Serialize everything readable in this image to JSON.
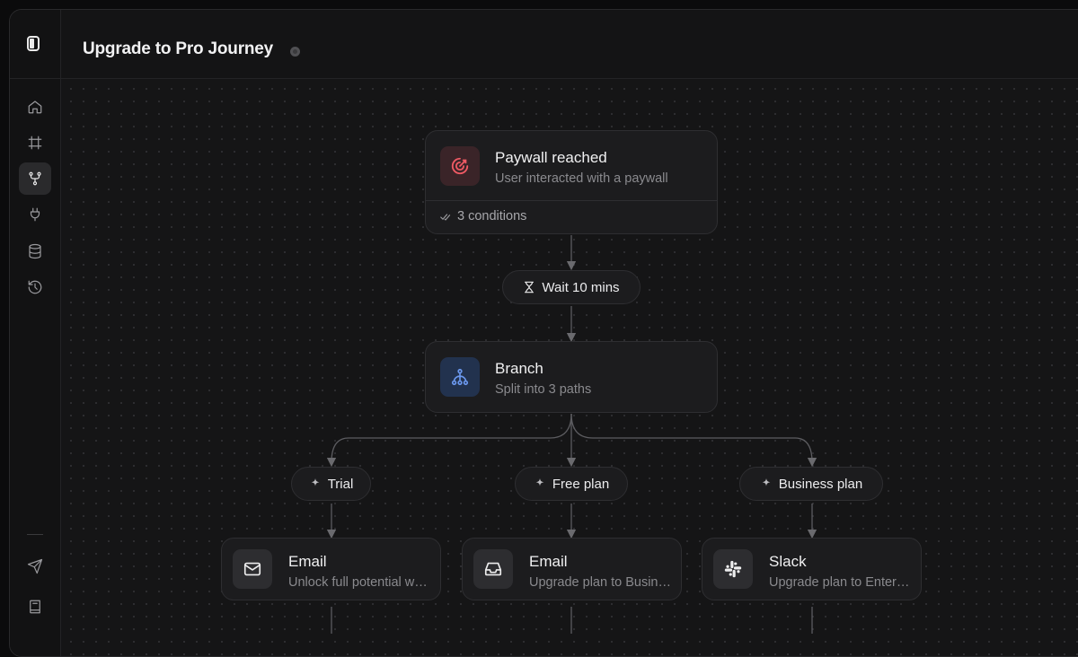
{
  "header": {
    "title": "Upgrade to Pro Journey"
  },
  "sidebar": {
    "items": [
      {
        "icon": "home-icon"
      },
      {
        "icon": "frame-icon"
      },
      {
        "icon": "git-branch-icon",
        "active": true
      },
      {
        "icon": "plug-icon"
      },
      {
        "icon": "database-icon"
      },
      {
        "icon": "history-icon"
      }
    ],
    "bottom": [
      {
        "icon": "send-icon"
      },
      {
        "icon": "book-icon"
      }
    ]
  },
  "flow": {
    "trigger": {
      "title": "Paywall reached",
      "subtitle": "User interacted with a paywall",
      "conditions": "3 conditions",
      "accent": "#e8505b"
    },
    "wait": {
      "label": "Wait 10 mins"
    },
    "branch": {
      "title": "Branch",
      "subtitle": "Split into 3 paths",
      "accent": "#5b8def"
    },
    "paths": [
      {
        "label": "Trial",
        "node": {
          "title": "Email",
          "subtitle": "Unlock full potential with Pro",
          "icon": "mail-icon"
        }
      },
      {
        "label": "Free plan",
        "node": {
          "title": "Email",
          "subtitle": "Upgrade plan to Business",
          "icon": "inbox-icon"
        }
      },
      {
        "label": "Business plan",
        "node": {
          "title": "Slack",
          "subtitle": "Upgrade plan to Enterprise",
          "icon": "slack-icon"
        }
      }
    ]
  },
  "colors": {
    "background": "#151516",
    "card": "#1c1c1e",
    "border": "#2e2e31"
  }
}
